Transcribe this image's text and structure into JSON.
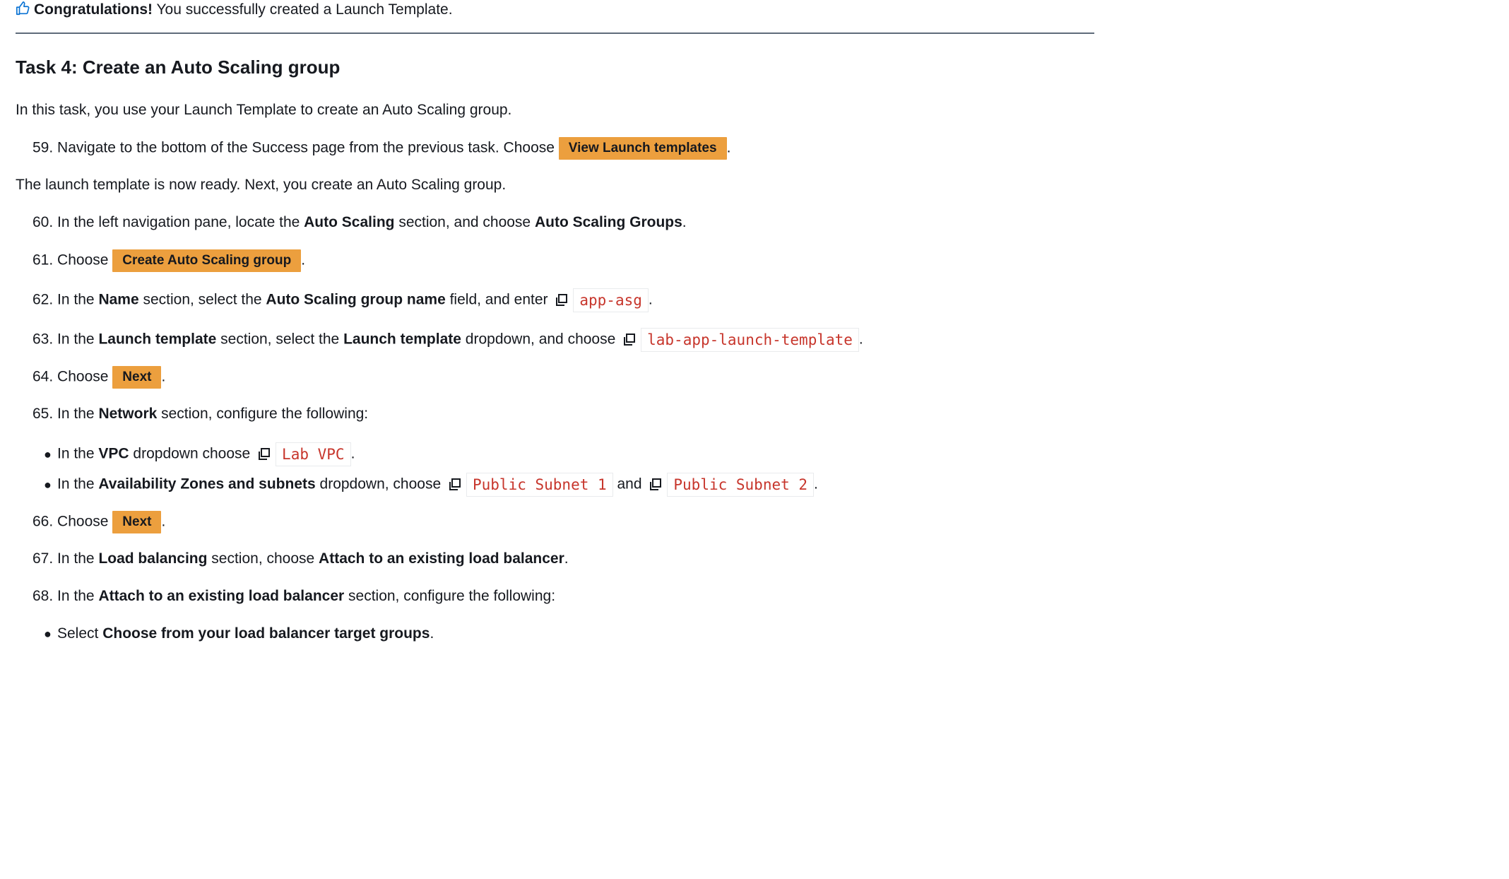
{
  "congrats": {
    "bold": "Congratulations!",
    "text": " You successfully created a Launch Template."
  },
  "heading": "Task 4: Create an Auto Scaling group",
  "intro": "In this task, you use your Launch Template to create an Auto Scaling group.",
  "step59": {
    "num": "59.",
    "text": "Navigate to the bottom of the Success page from the previous task. Choose",
    "button": "View Launch templates",
    "end": "."
  },
  "ready": "The launch template is now ready. Next, you create an Auto Scaling group.",
  "step60": {
    "num": "60.",
    "t1": "In the left navigation pane, locate the ",
    "b1": "Auto Scaling",
    "t2": " section, and choose ",
    "b2": "Auto Scaling Groups",
    "end": "."
  },
  "step61": {
    "num": "61.",
    "text": "Choose",
    "button": "Create Auto Scaling group",
    "end": "."
  },
  "step62": {
    "num": "62.",
    "t1": "In the ",
    "b1": "Name",
    "t2": " section, select the ",
    "b2": "Auto Scaling group name",
    "t3": " field, and enter",
    "code": "app-asg",
    "end": "."
  },
  "step63": {
    "num": "63.",
    "t1": "In the ",
    "b1": "Launch template",
    "t2": " section, select the ",
    "b2": "Launch template",
    "t3": " dropdown, and choose",
    "code": "lab-app-launch-template",
    "end": "."
  },
  "step64": {
    "num": "64.",
    "text": "Choose",
    "button": "Next",
    "end": "."
  },
  "step65": {
    "num": "65.",
    "t1": "In the ",
    "b1": "Network",
    "t2": " section, configure the following:"
  },
  "bullet_vpc": {
    "t1": "In the ",
    "b1": "VPC",
    "t2": " dropdown choose",
    "code": "Lab VPC",
    "end": "."
  },
  "bullet_az": {
    "t1": "In the ",
    "b1": "Availability Zones and subnets",
    "t2": " dropdown, choose",
    "code1": "Public Subnet 1",
    "and": "and",
    "code2": "Public Subnet 2",
    "end": "."
  },
  "step66": {
    "num": "66.",
    "text": "Choose",
    "button": "Next",
    "end": "."
  },
  "step67": {
    "num": "67.",
    "t1": "In the ",
    "b1": "Load balancing",
    "t2": " section, choose ",
    "b2": "Attach to an existing load balancer",
    "end": "."
  },
  "step68": {
    "num": "68.",
    "t1": "In the ",
    "b1": "Attach to an existing load balancer",
    "t2": " section, configure the following:"
  },
  "bullet_select": {
    "t1": "Select ",
    "b1": "Choose from your load balancer target groups",
    "end": "."
  },
  "colors": {
    "button": "#ec9f3e",
    "code": "#c7352b",
    "text": "#16191f"
  }
}
